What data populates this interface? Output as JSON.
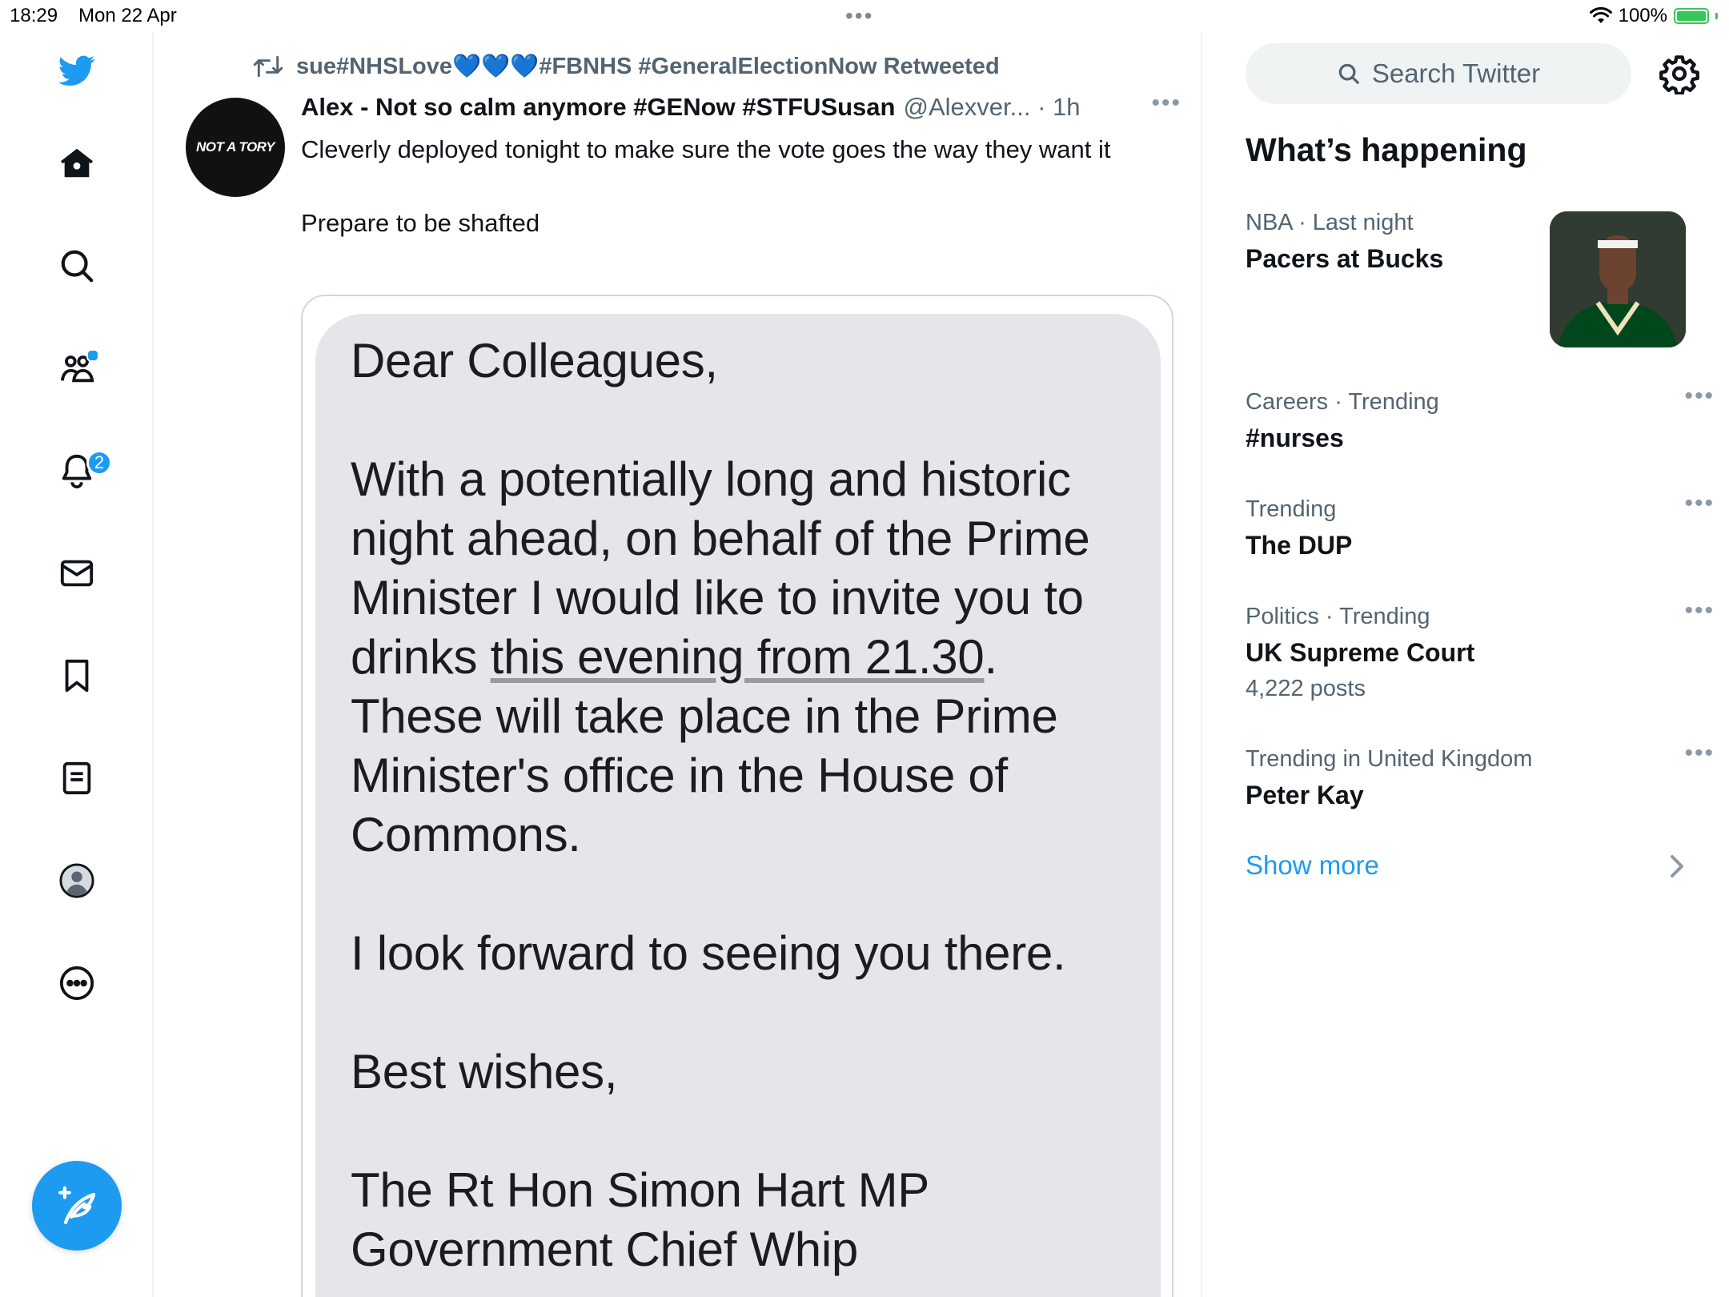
{
  "status_bar": {
    "time": "18:29",
    "date": "Mon 22 Apr",
    "battery": "100%",
    "battery_level": 1.0
  },
  "nav": {
    "notifications_badge": "2",
    "items": [
      "twitter-logo-icon",
      "home-icon",
      "search-icon",
      "communities-icon",
      "notifications-icon",
      "messages-icon",
      "bookmarks-icon",
      "lists-icon",
      "profile-icon",
      "more-icon"
    ]
  },
  "tweet": {
    "retweeted_by": "sue#NHSLove💙💙💙#FBNHS #GeneralElectionNow Retweeted",
    "avatar_text": "NOT A TORY",
    "author_name": "Alex - Not so calm anymore #GENow #STFUSusan",
    "author_handle": "@Alexver... · 1h",
    "text_line1": "Cleverly deployed tonight to make sure the vote goes the way they want it",
    "text_line2": "Prepare to be shafted",
    "image": {
      "greeting": "Dear Colleagues,",
      "body_part1": "With a potentially long and historic night ahead, on behalf of the Prime Minister I would like to invite you to drinks ",
      "body_link": "this evening from 21.30",
      "body_part2": ". These will take place in the Prime Minister's office in the House of Commons.",
      "look_forward": "I look forward to seeing you there.",
      "signoff": "Best wishes,",
      "sig_name": "The Rt Hon Simon Hart MP",
      "sig_title": "Government Chief Whip"
    }
  },
  "right": {
    "search_placeholder": "Search Twitter",
    "whats_happening": "What’s happening",
    "trends": [
      {
        "meta": "NBA · Last night",
        "title": "Pacers at Bucks"
      },
      {
        "meta": "Careers · Trending",
        "title": "#nurses"
      },
      {
        "meta": "Trending",
        "title": "The DUP"
      },
      {
        "meta": "Politics · Trending",
        "title": "UK Supreme Court",
        "posts": "4,222 posts"
      },
      {
        "meta": "Trending in United Kingdom",
        "title": "Peter Kay"
      }
    ],
    "show_more": "Show more"
  },
  "colors": {
    "accent": "#1d9bf0",
    "text_primary": "#0f1419",
    "text_secondary": "#536471",
    "bubble": "#e5e5ea",
    "battery": "#34c759"
  }
}
